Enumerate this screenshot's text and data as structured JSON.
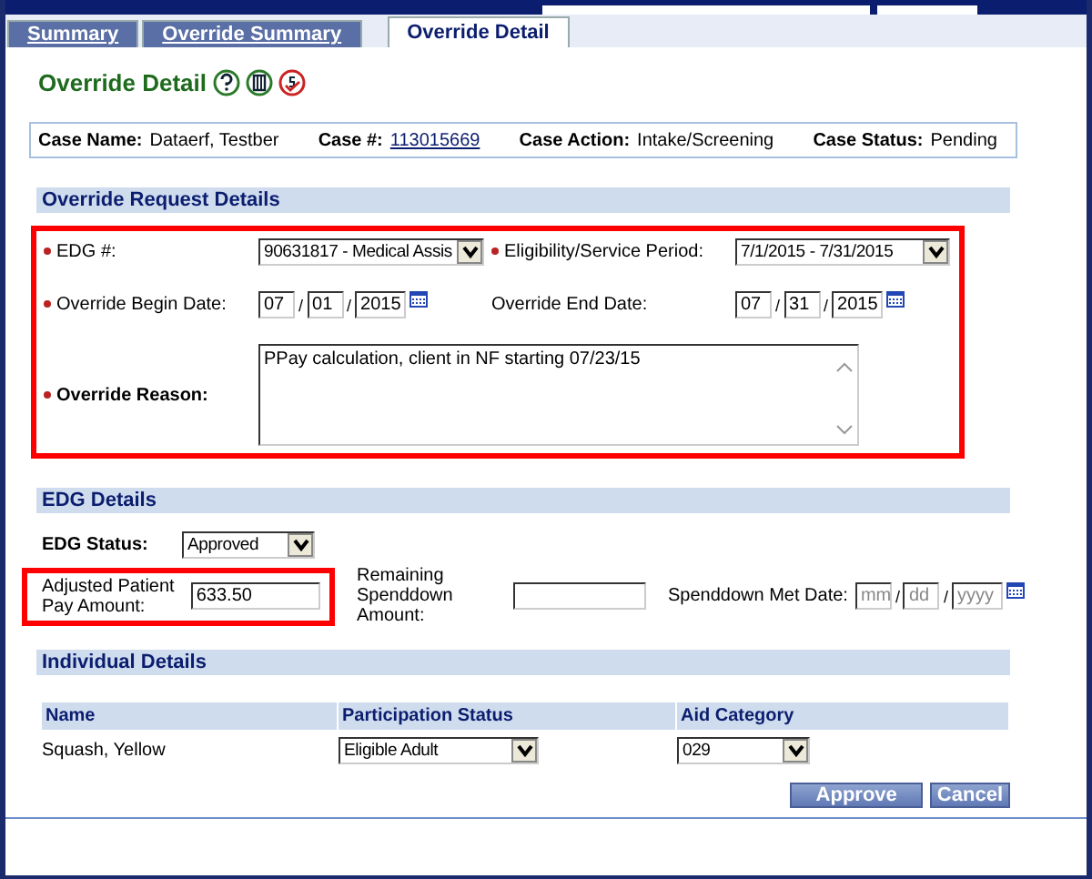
{
  "date_separator": "/",
  "tabs": [
    {
      "label": "Summary",
      "selected": false
    },
    {
      "label": "Override Summary",
      "selected": false
    },
    {
      "label": "Override Detail",
      "selected": true
    }
  ],
  "page_title": "Override Detail",
  "case_info": [
    {
      "label": "Case Name:",
      "value": "Dataerf, Testber",
      "kind": "text"
    },
    {
      "label": "Case #:",
      "value": "113015669",
      "kind": "link"
    },
    {
      "label": "Case Action:",
      "value": "Intake/Screening",
      "kind": "text"
    },
    {
      "label": "Case Status:",
      "value": "Pending",
      "kind": "text"
    }
  ],
  "override_request": {
    "title": "Override Request Details",
    "highlighted": true,
    "edg": {
      "label": "EDG #:",
      "required": true,
      "value": "90631817 - Medical Assis"
    },
    "period": {
      "label": "Eligibility/Service Period:",
      "required": true,
      "value": "7/1/2015 - 7/31/2015"
    },
    "begin_date": {
      "label": "Override Begin Date:",
      "required": true,
      "month": "07",
      "day": "01",
      "year": "2015"
    },
    "end_date": {
      "label": "Override End Date:",
      "month": "07",
      "day": "31",
      "year": "2015"
    },
    "reason": {
      "label": "Override Reason:",
      "required": true,
      "value": "PPay calculation, client in NF starting 07/23/15"
    }
  },
  "edg_details": {
    "title": "EDG Details",
    "status": {
      "label": "EDG Status:",
      "value": "Approved"
    },
    "patient_pay": {
      "label": "Adjusted Patient Pay Amount:",
      "value": "633.50",
      "highlighted": true
    },
    "spenddown": {
      "label": "Remaining Spenddown Amount:"
    },
    "met_date": {
      "label": "Spenddown Met Date:",
      "month": "mm",
      "day": "dd",
      "year": "yyyy"
    }
  },
  "individual_details": {
    "title": "Individual Details",
    "columns": [
      "Name",
      "Participation Status",
      "Aid Category"
    ],
    "rows": [
      {
        "name": "Squash, Yellow",
        "participation": "Eligible Adult",
        "aid": "029"
      }
    ]
  },
  "buttons": [
    "Approve",
    "Cancel"
  ]
}
